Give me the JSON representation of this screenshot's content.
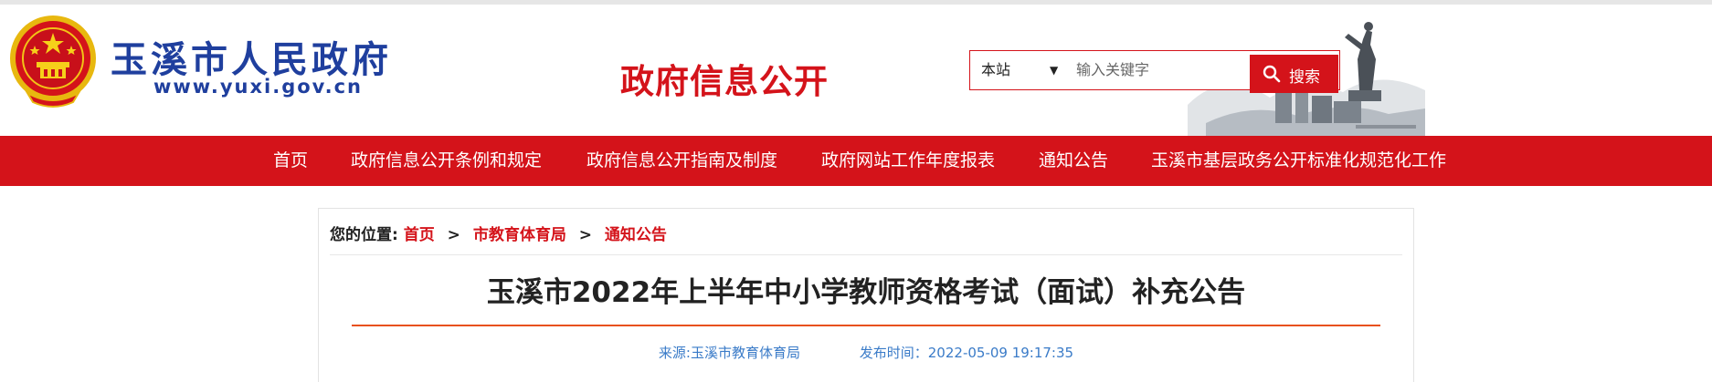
{
  "header": {
    "site_name": "玉溪市人民政府",
    "site_url": "www.yuxi.gov.cn",
    "portal_title": "政府信息公开",
    "emblem_icon": "national-emblem-icon"
  },
  "search": {
    "scope": "本站",
    "scope_caret": "▼",
    "placeholder": "输入关键字",
    "value": "",
    "button_label": "搜索"
  },
  "nav": {
    "items": [
      {
        "label": "首页"
      },
      {
        "label": "政府信息公开条例和规定"
      },
      {
        "label": "政府信息公开指南及制度"
      },
      {
        "label": "政府网站工作年度报表"
      },
      {
        "label": "通知公告"
      },
      {
        "label": "玉溪市基层政务公开标准化规范化工作"
      }
    ]
  },
  "breadcrumb": {
    "prefix": "您的位置:",
    "separator": ">",
    "items": [
      "首页",
      "市教育体育局",
      "通知公告"
    ]
  },
  "article": {
    "title": "玉溪市2022年上半年中小学教师资格考试（面试）补充公告",
    "source": "来源:玉溪市教育体育局",
    "publish_time": "发布时间：2022-05-09 19:17:35"
  },
  "colors": {
    "brand_red": "#d4131a",
    "site_blue": "#1f3f9e",
    "meta_blue": "#3a7bc8",
    "title_rule": "#e8501a"
  }
}
